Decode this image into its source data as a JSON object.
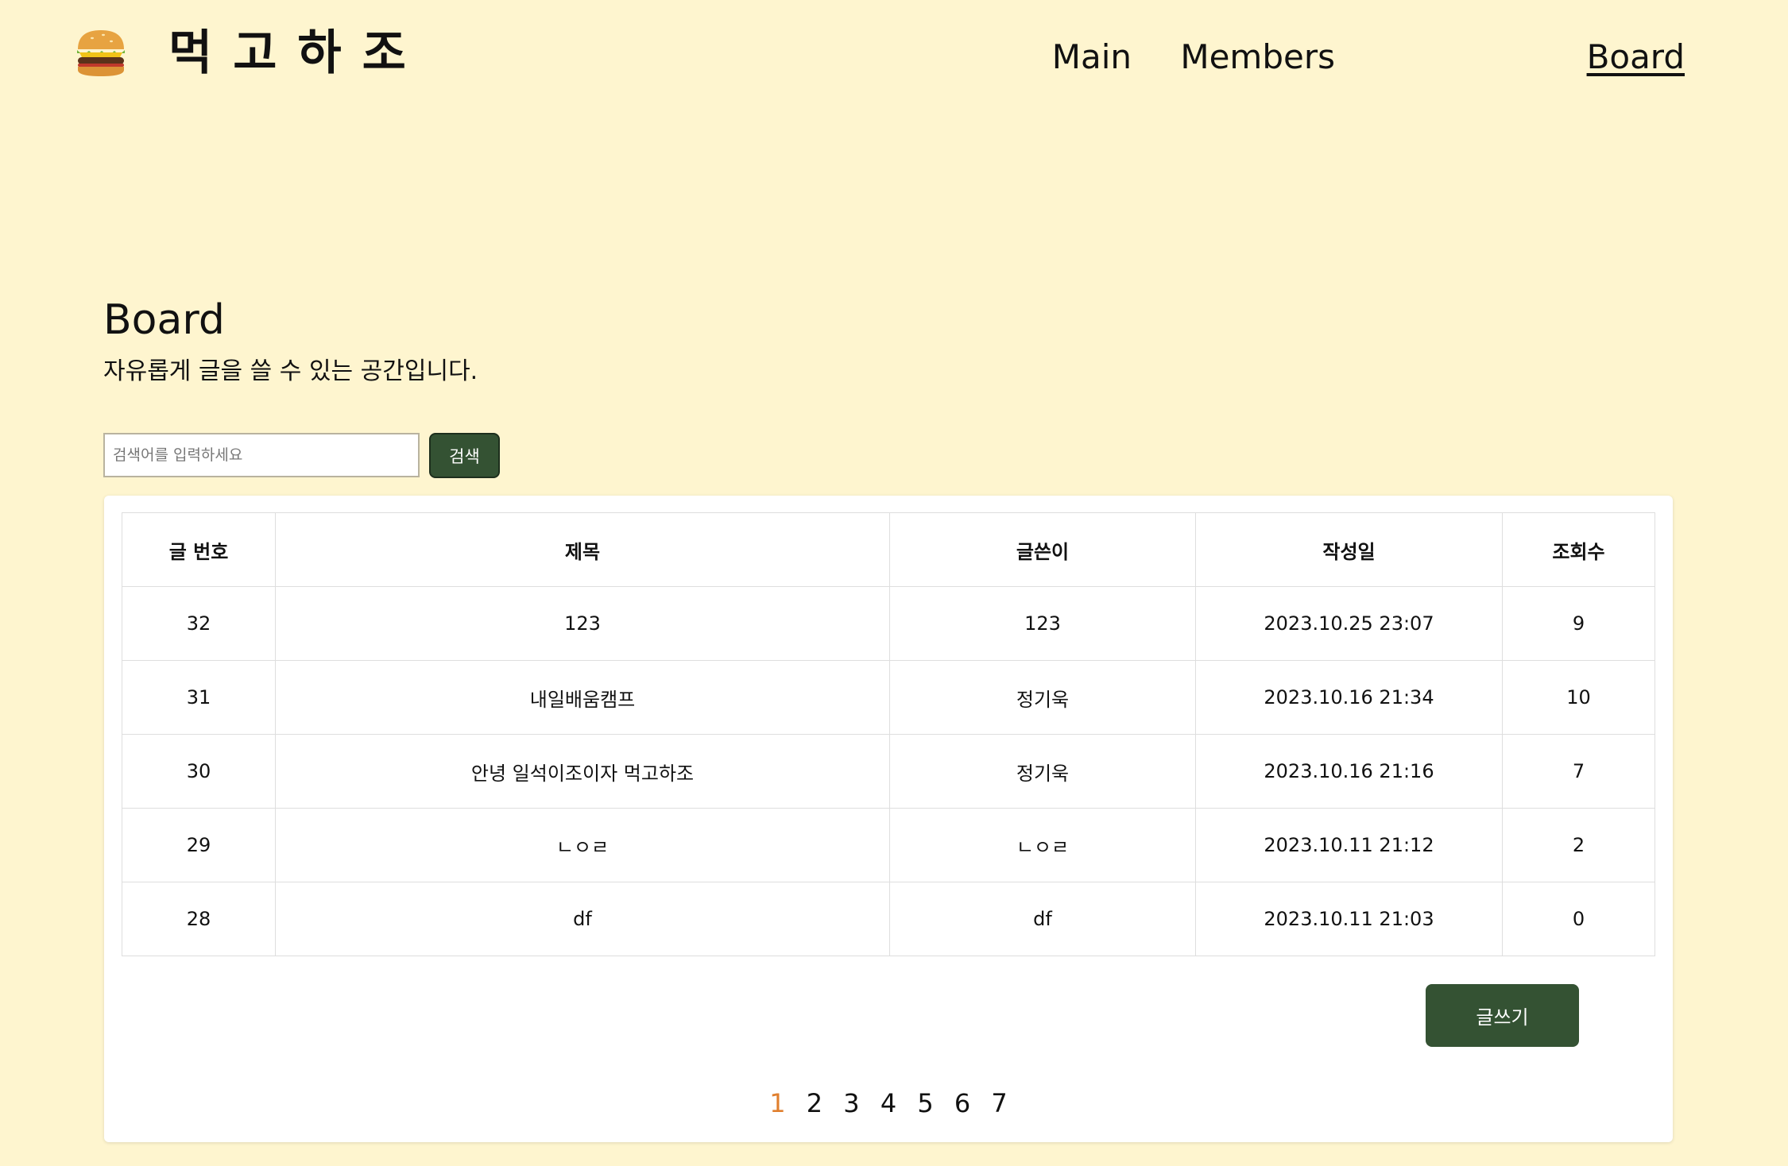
{
  "header": {
    "logo_icon": "hamburger-icon",
    "site_title": "먹고하조",
    "nav": [
      {
        "label": "Main",
        "active": false
      },
      {
        "label": "Members",
        "active": false
      },
      {
        "label": "Board",
        "active": true
      }
    ]
  },
  "intro": {
    "title": "Board",
    "subtitle": "자유롭게 글을 쓸 수 있는 공간입니다."
  },
  "search": {
    "placeholder": "검색어를 입력하세요",
    "button_label": "검색"
  },
  "table": {
    "columns": [
      "글 번호",
      "제목",
      "글쓴이",
      "작성일",
      "조회수"
    ],
    "rows": [
      [
        "32",
        "123",
        "123",
        "2023.10.25 23:07",
        "9"
      ],
      [
        "31",
        "내일배움캠프",
        "정기욱",
        "2023.10.16 21:34",
        "10"
      ],
      [
        "30",
        "안녕 일석이조이자 먹고하조",
        "정기욱",
        "2023.10.16 21:16",
        "7"
      ],
      [
        "29",
        "ㄴㅇㄹ",
        "ㄴㅇㄹ",
        "2023.10.11 21:12",
        "2"
      ],
      [
        "28",
        "df",
        "df",
        "2023.10.11 21:03",
        "0"
      ]
    ]
  },
  "write_button_label": "글쓰기",
  "pagination": {
    "pages": [
      "1",
      "2",
      "3",
      "4",
      "5",
      "6",
      "7"
    ],
    "current": "1"
  },
  "colors": {
    "background": "#fef5cf",
    "button": "#345233",
    "current_page": "#e07f2e"
  }
}
